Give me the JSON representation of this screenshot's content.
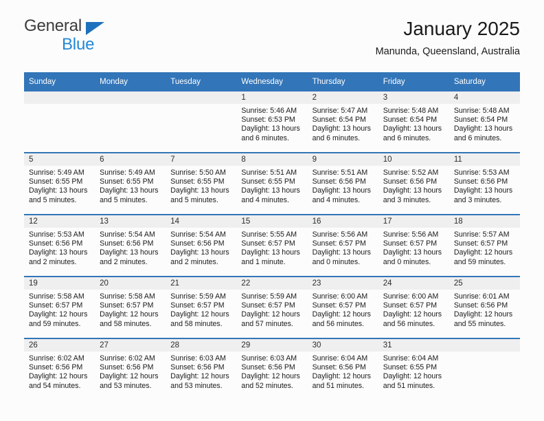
{
  "brand": {
    "name_part1": "General",
    "name_part2": "Blue",
    "triangle_color": "#1e71bc",
    "blue_color": "#2487d6"
  },
  "header": {
    "title": "January 2025",
    "subtitle": "Manunda, Queensland, Australia"
  },
  "theme": {
    "header_row_bg": "#3275b8",
    "daynum_band_bg": "#efefef",
    "page_bg": "#fcfcfc",
    "text_color": "#1a1a1a"
  },
  "weekday_headers": [
    "Sunday",
    "Monday",
    "Tuesday",
    "Wednesday",
    "Thursday",
    "Friday",
    "Saturday"
  ],
  "labels": {
    "sunrise_prefix": "Sunrise:",
    "sunset_prefix": "Sunset:",
    "daylight_prefix": "Daylight:"
  },
  "weeks": [
    [
      {
        "empty": true
      },
      {
        "empty": true
      },
      {
        "empty": true
      },
      {
        "empty": false,
        "day": "1",
        "sunrise": "Sunrise: 5:46 AM",
        "sunset": "Sunset: 6:53 PM",
        "daylight_line1": "Daylight: 13 hours",
        "daylight_line2": "and 6 minutes."
      },
      {
        "empty": false,
        "day": "2",
        "sunrise": "Sunrise: 5:47 AM",
        "sunset": "Sunset: 6:54 PM",
        "daylight_line1": "Daylight: 13 hours",
        "daylight_line2": "and 6 minutes."
      },
      {
        "empty": false,
        "day": "3",
        "sunrise": "Sunrise: 5:48 AM",
        "sunset": "Sunset: 6:54 PM",
        "daylight_line1": "Daylight: 13 hours",
        "daylight_line2": "and 6 minutes."
      },
      {
        "empty": false,
        "day": "4",
        "sunrise": "Sunrise: 5:48 AM",
        "sunset": "Sunset: 6:54 PM",
        "daylight_line1": "Daylight: 13 hours",
        "daylight_line2": "and 6 minutes."
      }
    ],
    [
      {
        "empty": false,
        "day": "5",
        "sunrise": "Sunrise: 5:49 AM",
        "sunset": "Sunset: 6:55 PM",
        "daylight_line1": "Daylight: 13 hours",
        "daylight_line2": "and 5 minutes."
      },
      {
        "empty": false,
        "day": "6",
        "sunrise": "Sunrise: 5:49 AM",
        "sunset": "Sunset: 6:55 PM",
        "daylight_line1": "Daylight: 13 hours",
        "daylight_line2": "and 5 minutes."
      },
      {
        "empty": false,
        "day": "7",
        "sunrise": "Sunrise: 5:50 AM",
        "sunset": "Sunset: 6:55 PM",
        "daylight_line1": "Daylight: 13 hours",
        "daylight_line2": "and 5 minutes."
      },
      {
        "empty": false,
        "day": "8",
        "sunrise": "Sunrise: 5:51 AM",
        "sunset": "Sunset: 6:55 PM",
        "daylight_line1": "Daylight: 13 hours",
        "daylight_line2": "and 4 minutes."
      },
      {
        "empty": false,
        "day": "9",
        "sunrise": "Sunrise: 5:51 AM",
        "sunset": "Sunset: 6:56 PM",
        "daylight_line1": "Daylight: 13 hours",
        "daylight_line2": "and 4 minutes."
      },
      {
        "empty": false,
        "day": "10",
        "sunrise": "Sunrise: 5:52 AM",
        "sunset": "Sunset: 6:56 PM",
        "daylight_line1": "Daylight: 13 hours",
        "daylight_line2": "and 3 minutes."
      },
      {
        "empty": false,
        "day": "11",
        "sunrise": "Sunrise: 5:53 AM",
        "sunset": "Sunset: 6:56 PM",
        "daylight_line1": "Daylight: 13 hours",
        "daylight_line2": "and 3 minutes."
      }
    ],
    [
      {
        "empty": false,
        "day": "12",
        "sunrise": "Sunrise: 5:53 AM",
        "sunset": "Sunset: 6:56 PM",
        "daylight_line1": "Daylight: 13 hours",
        "daylight_line2": "and 2 minutes."
      },
      {
        "empty": false,
        "day": "13",
        "sunrise": "Sunrise: 5:54 AM",
        "sunset": "Sunset: 6:56 PM",
        "daylight_line1": "Daylight: 13 hours",
        "daylight_line2": "and 2 minutes."
      },
      {
        "empty": false,
        "day": "14",
        "sunrise": "Sunrise: 5:54 AM",
        "sunset": "Sunset: 6:56 PM",
        "daylight_line1": "Daylight: 13 hours",
        "daylight_line2": "and 2 minutes."
      },
      {
        "empty": false,
        "day": "15",
        "sunrise": "Sunrise: 5:55 AM",
        "sunset": "Sunset: 6:57 PM",
        "daylight_line1": "Daylight: 13 hours",
        "daylight_line2": "and 1 minute."
      },
      {
        "empty": false,
        "day": "16",
        "sunrise": "Sunrise: 5:56 AM",
        "sunset": "Sunset: 6:57 PM",
        "daylight_line1": "Daylight: 13 hours",
        "daylight_line2": "and 0 minutes."
      },
      {
        "empty": false,
        "day": "17",
        "sunrise": "Sunrise: 5:56 AM",
        "sunset": "Sunset: 6:57 PM",
        "daylight_line1": "Daylight: 13 hours",
        "daylight_line2": "and 0 minutes."
      },
      {
        "empty": false,
        "day": "18",
        "sunrise": "Sunrise: 5:57 AM",
        "sunset": "Sunset: 6:57 PM",
        "daylight_line1": "Daylight: 12 hours",
        "daylight_line2": "and 59 minutes."
      }
    ],
    [
      {
        "empty": false,
        "day": "19",
        "sunrise": "Sunrise: 5:58 AM",
        "sunset": "Sunset: 6:57 PM",
        "daylight_line1": "Daylight: 12 hours",
        "daylight_line2": "and 59 minutes."
      },
      {
        "empty": false,
        "day": "20",
        "sunrise": "Sunrise: 5:58 AM",
        "sunset": "Sunset: 6:57 PM",
        "daylight_line1": "Daylight: 12 hours",
        "daylight_line2": "and 58 minutes."
      },
      {
        "empty": false,
        "day": "21",
        "sunrise": "Sunrise: 5:59 AM",
        "sunset": "Sunset: 6:57 PM",
        "daylight_line1": "Daylight: 12 hours",
        "daylight_line2": "and 58 minutes."
      },
      {
        "empty": false,
        "day": "22",
        "sunrise": "Sunrise: 5:59 AM",
        "sunset": "Sunset: 6:57 PM",
        "daylight_line1": "Daylight: 12 hours",
        "daylight_line2": "and 57 minutes."
      },
      {
        "empty": false,
        "day": "23",
        "sunrise": "Sunrise: 6:00 AM",
        "sunset": "Sunset: 6:57 PM",
        "daylight_line1": "Daylight: 12 hours",
        "daylight_line2": "and 56 minutes."
      },
      {
        "empty": false,
        "day": "24",
        "sunrise": "Sunrise: 6:00 AM",
        "sunset": "Sunset: 6:57 PM",
        "daylight_line1": "Daylight: 12 hours",
        "daylight_line2": "and 56 minutes."
      },
      {
        "empty": false,
        "day": "25",
        "sunrise": "Sunrise: 6:01 AM",
        "sunset": "Sunset: 6:56 PM",
        "daylight_line1": "Daylight: 12 hours",
        "daylight_line2": "and 55 minutes."
      }
    ],
    [
      {
        "empty": false,
        "day": "26",
        "sunrise": "Sunrise: 6:02 AM",
        "sunset": "Sunset: 6:56 PM",
        "daylight_line1": "Daylight: 12 hours",
        "daylight_line2": "and 54 minutes."
      },
      {
        "empty": false,
        "day": "27",
        "sunrise": "Sunrise: 6:02 AM",
        "sunset": "Sunset: 6:56 PM",
        "daylight_line1": "Daylight: 12 hours",
        "daylight_line2": "and 53 minutes."
      },
      {
        "empty": false,
        "day": "28",
        "sunrise": "Sunrise: 6:03 AM",
        "sunset": "Sunset: 6:56 PM",
        "daylight_line1": "Daylight: 12 hours",
        "daylight_line2": "and 53 minutes."
      },
      {
        "empty": false,
        "day": "29",
        "sunrise": "Sunrise: 6:03 AM",
        "sunset": "Sunset: 6:56 PM",
        "daylight_line1": "Daylight: 12 hours",
        "daylight_line2": "and 52 minutes."
      },
      {
        "empty": false,
        "day": "30",
        "sunrise": "Sunrise: 6:04 AM",
        "sunset": "Sunset: 6:56 PM",
        "daylight_line1": "Daylight: 12 hours",
        "daylight_line2": "and 51 minutes."
      },
      {
        "empty": false,
        "day": "31",
        "sunrise": "Sunrise: 6:04 AM",
        "sunset": "Sunset: 6:55 PM",
        "daylight_line1": "Daylight: 12 hours",
        "daylight_line2": "and 51 minutes."
      },
      {
        "empty": true
      }
    ]
  ]
}
